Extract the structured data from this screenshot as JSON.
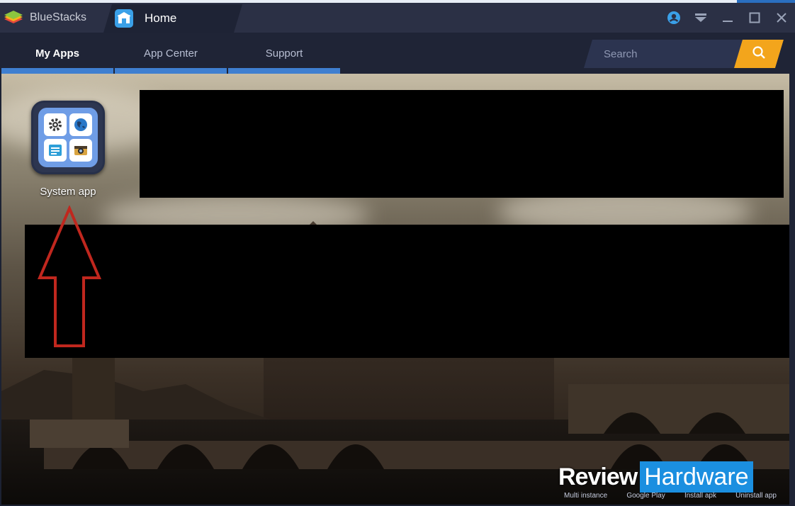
{
  "titlebar": {
    "app_name": "BlueStacks",
    "tab_label": "Home"
  },
  "nav": {
    "tabs": [
      {
        "label": "My Apps",
        "active": true
      },
      {
        "label": "App Center",
        "active": false
      },
      {
        "label": "Support",
        "active": false
      }
    ],
    "search_placeholder": "Search"
  },
  "apps": [
    {
      "label": "System app"
    }
  ],
  "watermark": {
    "part1": "Review",
    "part2": "Hardware"
  },
  "toolbar": {
    "items": [
      "Multi instance",
      "Google Play",
      "Install apk",
      "Uninstall app"
    ]
  },
  "colors": {
    "accent": "#3f7fd0",
    "search_button": "#f3a51c",
    "arrow": "#c0271e",
    "titlebar": "#2b3045"
  },
  "icons": [
    "bluestacks-logo-icon",
    "home-icon",
    "account-icon",
    "menu-dropdown-icon",
    "minimize-icon",
    "maximize-icon",
    "close-icon",
    "search-icon",
    "gear-icon",
    "globe-icon",
    "file-manager-icon",
    "camera-icon"
  ]
}
